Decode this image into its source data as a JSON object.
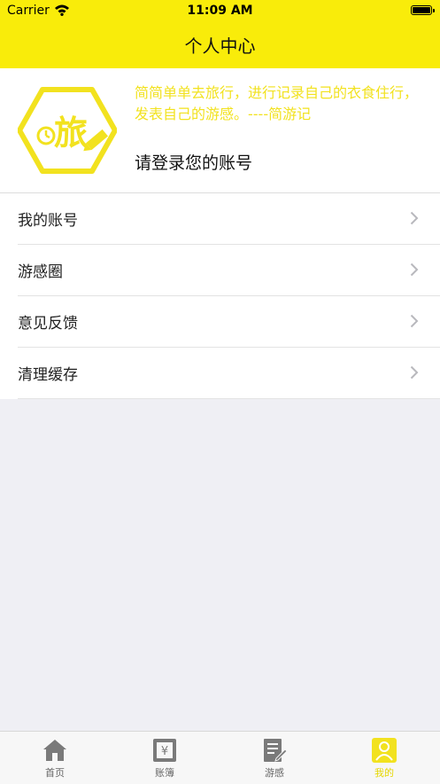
{
  "status_bar": {
    "carrier": "Carrier",
    "time": "11:09 AM"
  },
  "nav": {
    "title": "个人中心"
  },
  "profile": {
    "logo_text": "旅",
    "slogan": "简简单单去旅行，进行记录自己的衣食住行，发表自己的游感。----简游记",
    "login_prompt": "请登录您的账号"
  },
  "menu": {
    "items": [
      {
        "label": "我的账号"
      },
      {
        "label": "游感圈"
      },
      {
        "label": "意见反馈"
      },
      {
        "label": "清理缓存"
      }
    ]
  },
  "tabbar": {
    "items": [
      {
        "label": "首页",
        "icon": "home-icon"
      },
      {
        "label": "账簿",
        "icon": "ledger-icon"
      },
      {
        "label": "游感",
        "icon": "notes-icon"
      },
      {
        "label": "我的",
        "icon": "person-icon"
      }
    ]
  },
  "colors": {
    "brand_yellow": "#f9ec0a",
    "slogan": "#f2e21f",
    "background": "#efeff4"
  }
}
